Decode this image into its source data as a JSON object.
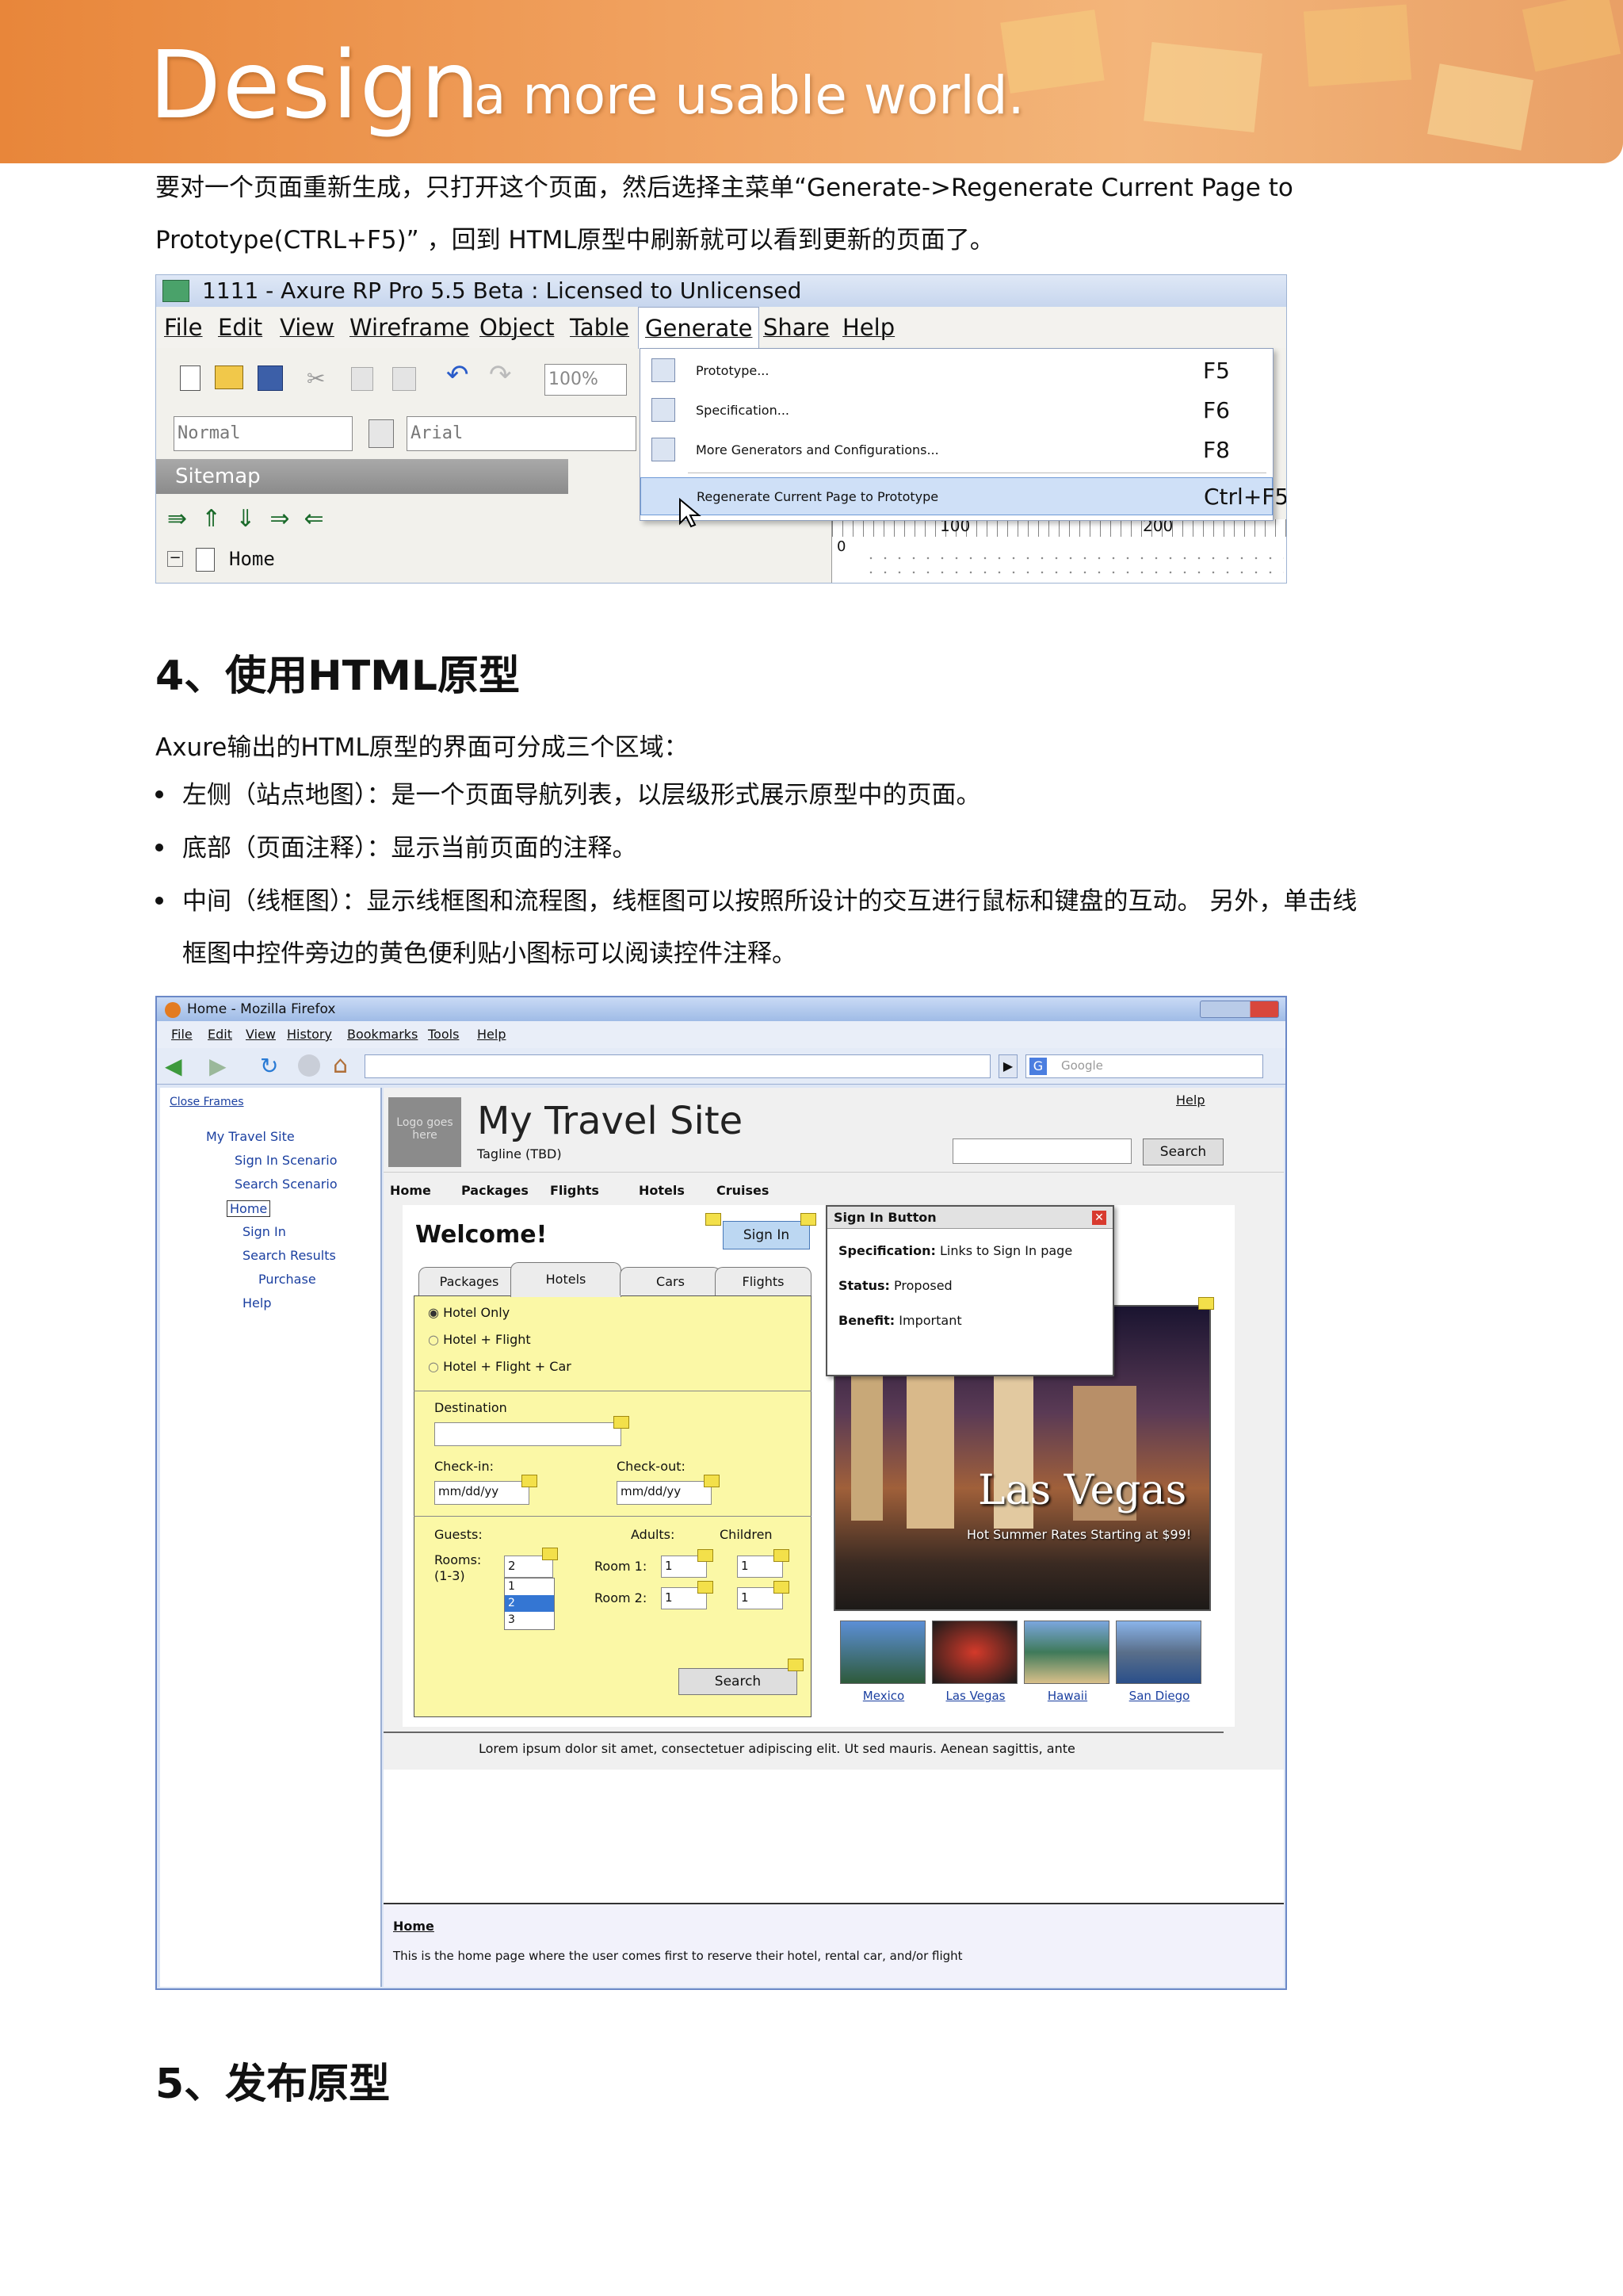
{
  "banner": {
    "word": "Design",
    "tagline": "a more usable world."
  },
  "intro": {
    "line1": "要对一个页面重新生成，只打开这个页面，然后选择主菜单“Generate->Regenerate Current Page to",
    "line2": "Prototype(CTRL+F5)” ，回到  HTML原型中刷新就可以看到更新的页面了。"
  },
  "shot1": {
    "window_title": "1111 - Axure RP Pro 5.5 Beta : Licensed to Unlicensed",
    "menu": [
      "File",
      "Edit",
      "View",
      "Wireframe",
      "Object",
      "Table",
      "Generate",
      "Share",
      "Help"
    ],
    "zoom": "100%",
    "style_select": "Normal",
    "font_select": "Arial",
    "dropdown": [
      {
        "label": "Prototype...",
        "key": "F5"
      },
      {
        "label": "Specification...",
        "key": "F6"
      },
      {
        "label": "More Generators and Configurations...",
        "key": "F8"
      },
      {
        "label": "Regenerate Current Page to Prototype",
        "key": "Ctrl+F5"
      }
    ],
    "sitemap_label": "Sitemap",
    "tree_home": "Home",
    "ruler": [
      "0",
      "100",
      "200"
    ]
  },
  "section4": {
    "heading": "4、使用HTML原型",
    "lead": "Axure输出的HTML原型的界面可分成三个区域：",
    "bullets": [
      "左侧（站点地图）：是一个页面导航列表，以层级形式展示原型中的页面。",
      "底部（页面注释）：显示当前页面的注释。",
      "中间（线框图）：显示线框图和流程图，线框图可以按照所设计的交互进行鼠标和键盘的互动。  另外，单击线",
      "框图中控件旁边的黄色便利贴小图标可以阅读控件注释。"
    ]
  },
  "shot2": {
    "window_title": "Home - Mozilla Firefox",
    "menu": [
      "File",
      "Edit",
      "View",
      "History",
      "Bookmarks",
      "Tools",
      "Help"
    ],
    "search_engine": "Google",
    "sidebar": {
      "close_frames": "Close Frames",
      "items": [
        "My Travel Site",
        "Sign In Scenario",
        "Search Scenario",
        "Home",
        "Sign In",
        "Search Results",
        "Purchase",
        "Help"
      ]
    },
    "site": {
      "logo": "Logo goes here",
      "title": "My Travel Site",
      "tagline": "Tagline (TBD)",
      "help": "Help",
      "search_button": "Search",
      "nav": [
        "Home",
        "Packages",
        "Flights",
        "Hotels",
        "Cruises"
      ],
      "welcome": "Welcome!",
      "sign_in": "Sign In",
      "tabs": [
        "Packages",
        "Hotels",
        "Cars",
        "Flights"
      ],
      "options": [
        "Hotel Only",
        "Hotel + Flight",
        "Hotel + Flight + Car"
      ],
      "destination": "Destination",
      "checkin": "Check-in:",
      "checkout": "Check-out:",
      "date_placeholder": "mm/dd/yy",
      "guests": "Guests:",
      "rooms": "Rooms:",
      "rooms_range": "(1-3)",
      "rooms_value": "2",
      "rooms_options": [
        "1",
        "2",
        "3"
      ],
      "adults": "Adults:",
      "children": "Children",
      "room1": "Room 1:",
      "room2": "Room 2:",
      "count_value": "1",
      "form_search": "Search",
      "hero_title": "Las Vegas",
      "hero_sub": "Hot Summer Rates Starting at $99!",
      "thumbs": [
        "Mexico",
        "Las Vegas",
        "Hawaii",
        "San Diego"
      ],
      "lorem": "Lorem ipsum dolor sit amet, consectetuer adipiscing elit. Ut sed mauris. Aenean sagittis, ante"
    },
    "popup": {
      "title": "Sign In Button",
      "spec_label": "Specification:",
      "spec_value": "Links to Sign In page",
      "status_label": "Status:",
      "status_value": "Proposed",
      "benefit_label": "Benefit:",
      "benefit_value": "Important"
    },
    "notes": {
      "page": "Home",
      "text": "This is the home page where the user comes first to reserve their hotel, rental car, and/or flight"
    }
  },
  "section5": {
    "heading": "5、发布原型"
  }
}
